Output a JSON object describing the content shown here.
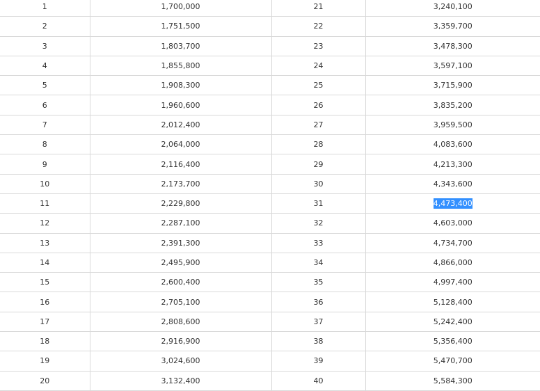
{
  "rows": [
    {
      "a": "1",
      "b": "1,700,000",
      "c": "21",
      "d": "3,240,100"
    },
    {
      "a": "2",
      "b": "1,751,500",
      "c": "22",
      "d": "3,359,700"
    },
    {
      "a": "3",
      "b": "1,803,700",
      "c": "23",
      "d": "3,478,300"
    },
    {
      "a": "4",
      "b": "1,855,800",
      "c": "24",
      "d": "3,597,100"
    },
    {
      "a": "5",
      "b": "1,908,300",
      "c": "25",
      "d": "3,715,900"
    },
    {
      "a": "6",
      "b": "1,960,600",
      "c": "26",
      "d": "3,835,200"
    },
    {
      "a": "7",
      "b": "2,012,400",
      "c": "27",
      "d": "3,959,500"
    },
    {
      "a": "8",
      "b": "2,064,000",
      "c": "28",
      "d": "4,083,600"
    },
    {
      "a": "9",
      "b": "2,116,400",
      "c": "29",
      "d": "4,213,300"
    },
    {
      "a": "10",
      "b": "2,173,700",
      "c": "30",
      "d": "4,343,600"
    },
    {
      "a": "11",
      "b": "2,229,800",
      "c": "31",
      "d": "4,473,400"
    },
    {
      "a": "12",
      "b": "2,287,100",
      "c": "32",
      "d": "4,603,000"
    },
    {
      "a": "13",
      "b": "2,391,300",
      "c": "33",
      "d": "4,734,700"
    },
    {
      "a": "14",
      "b": "2,495,900",
      "c": "34",
      "d": "4,866,000"
    },
    {
      "a": "15",
      "b": "2,600,400",
      "c": "35",
      "d": "4,997,400"
    },
    {
      "a": "16",
      "b": "2,705,100",
      "c": "36",
      "d": "5,128,400"
    },
    {
      "a": "17",
      "b": "2,808,600",
      "c": "37",
      "d": "5,242,400"
    },
    {
      "a": "18",
      "b": "2,916,900",
      "c": "38",
      "d": "5,356,400"
    },
    {
      "a": "19",
      "b": "3,024,600",
      "c": "39",
      "d": "5,470,700"
    },
    {
      "a": "20",
      "b": "3,132,400",
      "c": "40",
      "d": "5,584,300"
    }
  ],
  "selection": {
    "row": 10,
    "column": "d"
  },
  "colors": {
    "text": "#333333",
    "grid_line": "#d9d9d9",
    "selection_bg": "#3390ff",
    "selection_text": "#ffffff"
  }
}
